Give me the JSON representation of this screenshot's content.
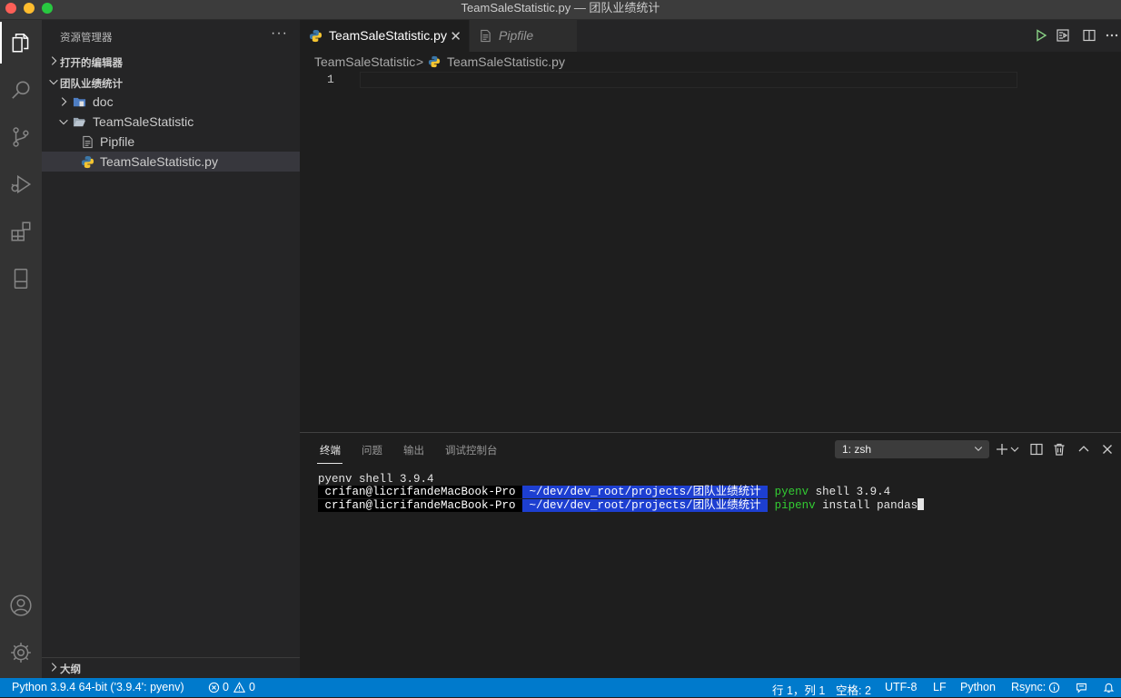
{
  "window": {
    "title": "TeamSaleStatistic.py — 团队业绩统计"
  },
  "colors": {
    "accent": "#007acc",
    "close_button": "#fe5f57",
    "minimize_button": "#febc2e",
    "zoom_button": "#28c840",
    "terminal_path_bg": "#1d3fd1",
    "terminal_command": "#33cc33"
  },
  "activity_bar": {
    "items": [
      {
        "name": "explorer",
        "icon": "files-icon",
        "active": true
      },
      {
        "name": "search",
        "icon": "search-icon"
      },
      {
        "name": "source-control",
        "icon": "source-control-icon"
      },
      {
        "name": "run-debug",
        "icon": "run-debug-icon"
      },
      {
        "name": "extensions",
        "icon": "extensions-icon"
      },
      {
        "name": "remote-explorer",
        "icon": "remote-explorer-icon"
      }
    ],
    "bottom_items": [
      {
        "name": "accounts",
        "icon": "account-icon"
      },
      {
        "name": "manage",
        "icon": "gear-icon"
      }
    ]
  },
  "sidebar": {
    "title": "资源管理器",
    "more_label": "···",
    "open_editors_label": "打开的编辑器",
    "workspace_label": "团队业绩统计",
    "tree": [
      {
        "label": "doc",
        "type": "folder",
        "expanded": false
      },
      {
        "label": "TeamSaleStatistic",
        "type": "folder",
        "expanded": true
      },
      {
        "label": "Pipfile",
        "type": "file"
      },
      {
        "label": "TeamSaleStatistic.py",
        "type": "python-file",
        "selected": true
      }
    ],
    "outline_label": "大纲"
  },
  "tabs": [
    {
      "label": "TeamSaleStatistic.py",
      "active": true,
      "close": "✕"
    },
    {
      "label": "Pipfile",
      "active": false
    }
  ],
  "breadcrumb": {
    "folder": "TeamSaleStatistic",
    "separator": ">",
    "file": "TeamSaleStatistic.py"
  },
  "editor": {
    "line_number": "1"
  },
  "panel": {
    "tabs": [
      "终端",
      "问题",
      "输出",
      "调试控制台"
    ],
    "active_tab": "终端",
    "terminal_select": "1: zsh",
    "terminal_lines": {
      "line1": "pyenv shell 3.9.4",
      "user": " crifan@licrifandeMacBook-Pro ",
      "path": " ~/dev/dev_root/projects/团队业绩统计 ",
      "line2_cmd": "pyenv",
      "line2_rest": " shell 3.9.4",
      "line3_cmd": "pipenv",
      "line3_rest": " install pandas"
    }
  },
  "status_bar": {
    "interpreter": "Python 3.9.4 64-bit ('3.9.4': pyenv)",
    "errors": "0",
    "warnings": "0",
    "cursor_position": "行 1，列 1",
    "indentation": "空格: 2",
    "encoding": "UTF-8",
    "eol": "LF",
    "language": "Python",
    "rsync": "Rsync:"
  }
}
